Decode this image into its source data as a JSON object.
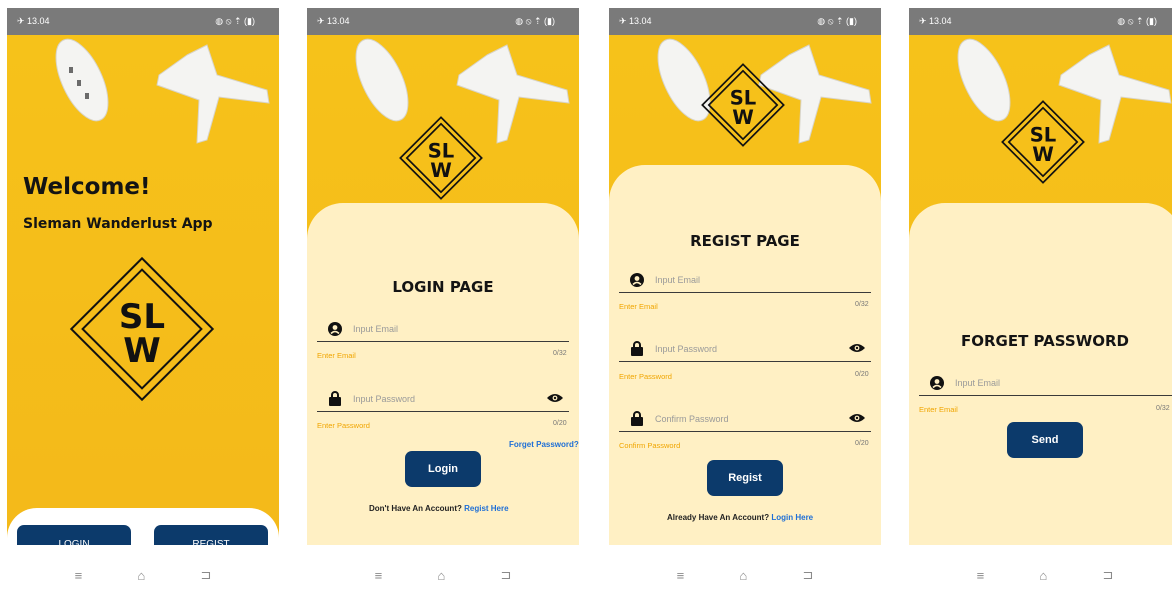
{
  "status": {
    "time": "✈ 13.04",
    "icons": "◍ ⦸ ⇡ (▮)"
  },
  "nav": {
    "menu": "≡",
    "home": "⌂",
    "back": "⊐"
  },
  "welcome": {
    "heading": "Welcome!",
    "subheading": "Sleman Wanderlust App",
    "login_label": "LOGIN",
    "regist_label": "REGIST"
  },
  "logo": {
    "line1": "SL",
    "line2": "W"
  },
  "login": {
    "title": "LOGIN PAGE",
    "email_placeholder": "Input Email",
    "email_hint": "Enter Email",
    "email_count": "0/32",
    "password_placeholder": "Input Password",
    "password_hint": "Enter Password",
    "password_count": "0/20",
    "forget_link": "Forget Password?",
    "login_label": "Login",
    "no_account": "Don't Have An Account?",
    "regist_link": "Regist Here"
  },
  "regist": {
    "title": "REGIST PAGE",
    "email_placeholder": "Input Email",
    "email_hint": "Enter Email",
    "email_count": "0/32",
    "password_placeholder": "Input Password",
    "password_hint": "Enter Password",
    "password_count": "0/20",
    "confirm_placeholder": "Confirm Password",
    "confirm_hint": "Confirm Password",
    "confirm_count": "0/20",
    "regist_label": "Regist",
    "have_account": "Already Have An Account?",
    "login_link": "Login Here"
  },
  "forget": {
    "title": "FORGET PASSWORD",
    "email_placeholder": "Input Email",
    "email_hint": "Enter Email",
    "email_count": "0/32",
    "send_label": "Send"
  },
  "colors": {
    "yellow": "#f6c21a",
    "cream": "#fff0c4",
    "navy": "#0c3a6b",
    "link": "#1f6fd6",
    "hint": "#f0a500"
  }
}
